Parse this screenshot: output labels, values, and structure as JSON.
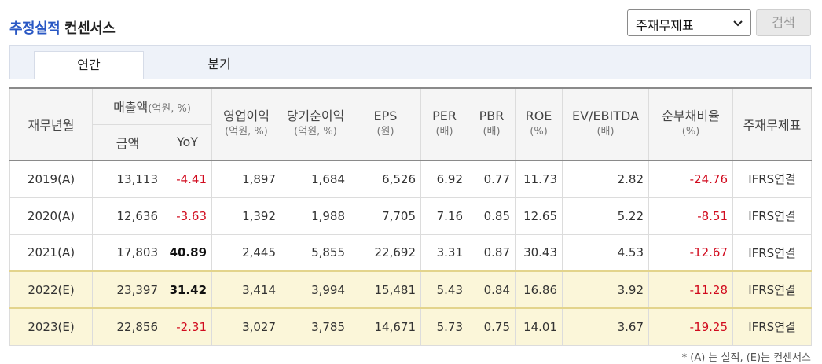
{
  "title": {
    "accent": "추정실적",
    "rest": "컨센서스"
  },
  "select": {
    "value": "주재무제표"
  },
  "search_button": "검색",
  "tabs": [
    {
      "label": "연간"
    },
    {
      "label": "분기"
    }
  ],
  "headers": {
    "year": "재무년월",
    "sales": "매출액",
    "sales_unit": "(억원, %)",
    "amount": "금액",
    "yoy": "YoY",
    "op": "영업이익",
    "op_unit": "(억원, %)",
    "net": "당기순이익",
    "net_unit": "(억원, %)",
    "eps": "EPS",
    "eps_unit": "(원)",
    "per": "PER",
    "per_unit": "(배)",
    "pbr": "PBR",
    "pbr_unit": "(배)",
    "roe": "ROE",
    "roe_unit": "(%)",
    "ev": "EV/EBITDA",
    "ev_unit": "(배)",
    "debt": "순부채비율",
    "debt_unit": "(%)",
    "std": "주재무제표"
  },
  "rows": [
    {
      "year": "2019(A)",
      "amount": "13,113",
      "yoy": "-4.41",
      "op": "1,897",
      "net": "1,684",
      "eps": "6,526",
      "per": "6.92",
      "pbr": "0.77",
      "roe": "11.73",
      "ev": "2.82",
      "debt": "-24.76",
      "std": "IFRS연결"
    },
    {
      "year": "2020(A)",
      "amount": "12,636",
      "yoy": "-3.63",
      "op": "1,392",
      "net": "1,988",
      "eps": "7,705",
      "per": "7.16",
      "pbr": "0.85",
      "roe": "12.65",
      "ev": "5.22",
      "debt": "-8.51",
      "std": "IFRS연결"
    },
    {
      "year": "2021(A)",
      "amount": "17,803",
      "yoy": "40.89",
      "op": "2,445",
      "net": "5,855",
      "eps": "22,692",
      "per": "3.31",
      "pbr": "0.87",
      "roe": "30.43",
      "ev": "4.53",
      "debt": "-12.67",
      "std": "IFRS연결"
    },
    {
      "year": "2022(E)",
      "amount": "23,397",
      "yoy": "31.42",
      "op": "3,414",
      "net": "3,994",
      "eps": "15,481",
      "per": "5.43",
      "pbr": "0.84",
      "roe": "16.86",
      "ev": "3.92",
      "debt": "-11.28",
      "std": "IFRS연결"
    },
    {
      "year": "2023(E)",
      "amount": "22,856",
      "yoy": "-2.31",
      "op": "3,027",
      "net": "3,785",
      "eps": "14,671",
      "per": "5.73",
      "pbr": "0.75",
      "roe": "14.01",
      "ev": "3.67",
      "debt": "-19.25",
      "std": "IFRS연결"
    }
  ],
  "footnote": "* (A) 는 실적, (E)는 컨센서스",
  "colors": {
    "accent": "#2a58c4",
    "negative": "#d10b1e",
    "estimate_bg": "#fbf6d9"
  }
}
